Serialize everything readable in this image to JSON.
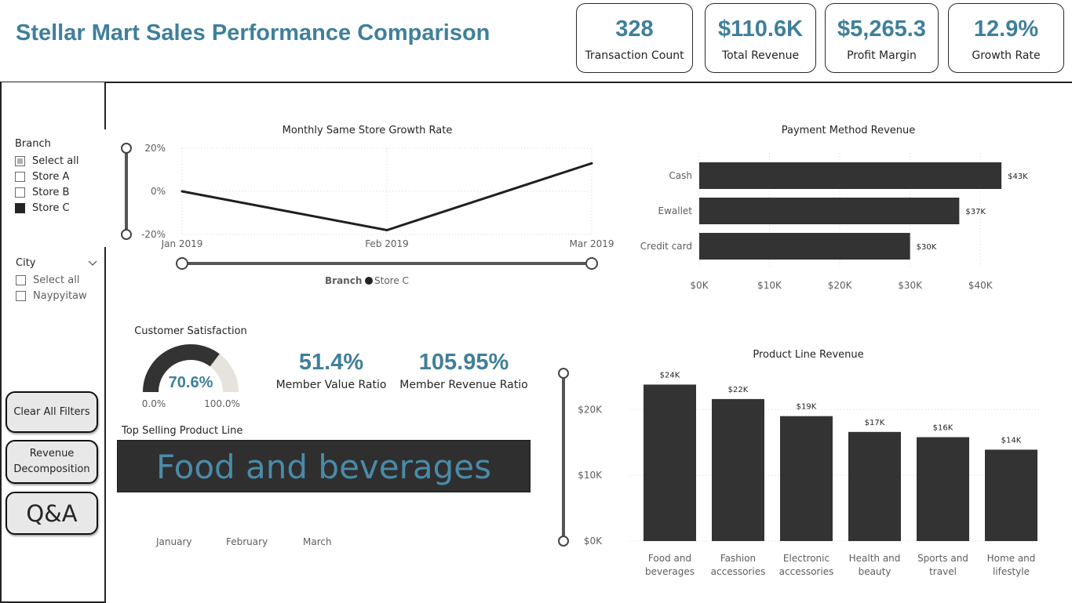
{
  "title": "Stellar Mart Sales Performance Comparison",
  "kpis": [
    {
      "value": "328",
      "label": "Transaction Count"
    },
    {
      "value": "$110.6K",
      "label": "Total Revenue"
    },
    {
      "value": "$5,265.3",
      "label": "Profit Margin"
    },
    {
      "value": "12.9%",
      "label": "Growth Rate"
    }
  ],
  "sidebar": {
    "branch": {
      "title": "Branch",
      "items": [
        {
          "label": "Select all",
          "state": "partial"
        },
        {
          "label": "Store A",
          "state": "unchecked"
        },
        {
          "label": "Store B",
          "state": "unchecked"
        },
        {
          "label": "Store C",
          "state": "checked"
        }
      ]
    },
    "city": {
      "title": "City",
      "items": [
        {
          "label": "Select all",
          "state": "unchecked"
        },
        {
          "label": "Naypyitaw",
          "state": "unchecked"
        }
      ]
    },
    "buttons": {
      "clear": "Clear All Filters",
      "decomp_line1": "Revenue",
      "decomp_line2": "Decomposition",
      "qa": "Q&A"
    }
  },
  "growth_chart": {
    "legend_title": "Branch",
    "legend_item": "Store C"
  },
  "gauge": {
    "title": "Customer Satisfaction",
    "value_label": "70.6%",
    "min_label": "0.0%",
    "max_label": "100.0%",
    "fraction": 0.706,
    "fill_color": "#333333",
    "track_color": "#e6e2dc"
  },
  "metrics": [
    {
      "value": "51.4%",
      "label": "Member Value Ratio"
    },
    {
      "value": "105.95%",
      "label": "Member Revenue Ratio"
    }
  ],
  "top_product": {
    "title": "Top Selling Product Line",
    "value": "Food and beverages"
  },
  "month_labels": [
    "January",
    "February",
    "March"
  ],
  "colors": {
    "accent": "#3f7f9b",
    "bar": "#333333"
  },
  "chart_data": [
    {
      "type": "line",
      "title": "Monthly Same Store Growth Rate",
      "x": [
        "Jan 2019",
        "Feb 2019",
        "Mar 2019"
      ],
      "series": [
        {
          "name": "Store C",
          "values": [
            0,
            -18,
            13
          ]
        }
      ],
      "ylim": [
        -20,
        20
      ],
      "yticks": [
        {
          "v": 20,
          "label": "20%"
        },
        {
          "v": 0,
          "label": "0%"
        },
        {
          "v": -20,
          "label": "-20%"
        }
      ],
      "grid": true,
      "legend": "bottom"
    },
    {
      "type": "bar",
      "orientation": "horizontal",
      "title": "Payment Method Revenue",
      "categories": [
        "Cash",
        "Ewallet",
        "Credit card"
      ],
      "values": [
        43,
        37,
        30
      ],
      "value_labels": [
        "$43K",
        "$37K",
        "$30K"
      ],
      "xlim": [
        0,
        45
      ],
      "xticks": [
        {
          "v": 0,
          "label": "$0K"
        },
        {
          "v": 10,
          "label": "$10K"
        },
        {
          "v": 20,
          "label": "$20K"
        },
        {
          "v": 30,
          "label": "$30K"
        },
        {
          "v": 40,
          "label": "$40K"
        }
      ],
      "grid": true
    },
    {
      "type": "bar",
      "title": "Product Line Revenue",
      "categories": [
        [
          "Food and",
          "beverages"
        ],
        [
          "Fashion",
          "accessories"
        ],
        [
          "Electronic",
          "accessories"
        ],
        [
          "Health and",
          "beauty"
        ],
        [
          "Sports and",
          "travel"
        ],
        [
          "Home and",
          "lifestyle"
        ]
      ],
      "values": [
        23.8,
        21.6,
        19.0,
        16.6,
        15.8,
        13.9
      ],
      "value_labels": [
        "$24K",
        "$22K",
        "$19K",
        "$17K",
        "$16K",
        "$14K"
      ],
      "ylim": [
        0,
        26
      ],
      "yticks": [
        {
          "v": 0,
          "label": "$0K"
        },
        {
          "v": 10,
          "label": "$10K"
        },
        {
          "v": 20,
          "label": "$20K"
        }
      ],
      "grid": true
    }
  ]
}
